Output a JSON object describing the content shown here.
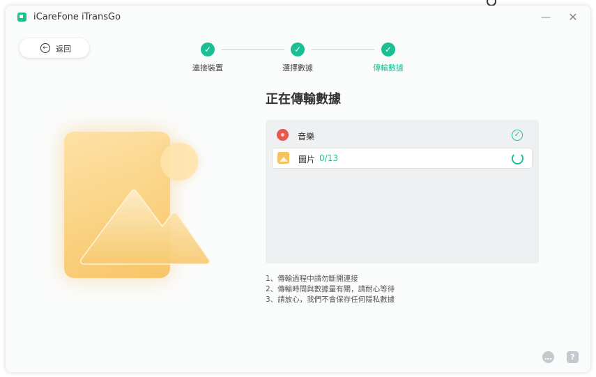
{
  "app": {
    "title": "iCareFone iTransGo"
  },
  "header": {
    "back_label": "返回"
  },
  "steps": [
    {
      "label": "連接裝置",
      "state": "done"
    },
    {
      "label": "選擇數據",
      "state": "done"
    },
    {
      "label": "傳輸數據",
      "state": "active"
    }
  ],
  "main": {
    "title": "正在傳輸數據",
    "items": [
      {
        "name": "音樂",
        "count": "",
        "status": "done",
        "icon": "music-icon"
      },
      {
        "name": "圖片",
        "count": "0/13",
        "status": "in-progress",
        "icon": "photo-icon"
      }
    ],
    "notes": [
      "1、傳輸過程中請勿斷開連接",
      "2、傳輸時間與數據量有關，請耐心等待",
      "3、請放心，我們不會保存任何隱私數據"
    ]
  },
  "colors": {
    "accent": "#1cbf94",
    "panel": "#eef0f1"
  }
}
